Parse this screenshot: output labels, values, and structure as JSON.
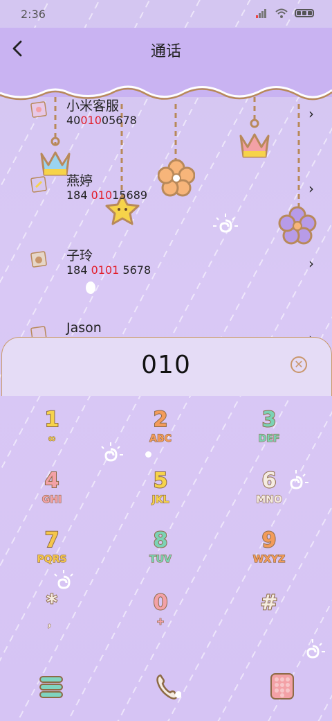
{
  "status": {
    "time": "2:36"
  },
  "header": {
    "title": "通话"
  },
  "contacts": [
    {
      "name": "小米客服",
      "num_pre": "40",
      "num_hl": "010",
      "num_post": "05678"
    },
    {
      "name": "燕婷",
      "num_pre": "184 ",
      "num_hl": "010",
      "num_post": "15689"
    },
    {
      "name": "子玲",
      "num_pre": "184 ",
      "num_hl": "0101",
      "num_post": " 5678"
    },
    {
      "name": "Jason",
      "num_pre": "",
      "num_hl": "",
      "num_post": ""
    }
  ],
  "dial": {
    "input": "010"
  },
  "keys": [
    {
      "digit": "1",
      "letters": "∞",
      "color": "#f6d34a"
    },
    {
      "digit": "2",
      "letters": "ABC",
      "color": "#f39b5a"
    },
    {
      "digit": "3",
      "letters": "DEF",
      "color": "#7bd3b5"
    },
    {
      "digit": "4",
      "letters": "GHI",
      "color": "#f3a1a6"
    },
    {
      "digit": "5",
      "letters": "JKL",
      "color": "#f6d34a"
    },
    {
      "digit": "6",
      "letters": "MNO",
      "color": "#f5ece2"
    },
    {
      "digit": "7",
      "letters": "PQRS",
      "color": "#f5c64a"
    },
    {
      "digit": "8",
      "letters": "TUV",
      "color": "#7bd3b5"
    },
    {
      "digit": "9",
      "letters": "WXYZ",
      "color": "#f39b5a"
    },
    {
      "digit": "*",
      "letters": "，",
      "color": "#f5ece2"
    },
    {
      "digit": "0",
      "letters": "+",
      "color": "#f3a1a6"
    },
    {
      "digit": "#",
      "letters": "",
      "color": "#f5ece2"
    }
  ],
  "colors": {
    "accent": "#e21e2a",
    "header": "#c9b3f2",
    "rope": "#b8895a"
  }
}
